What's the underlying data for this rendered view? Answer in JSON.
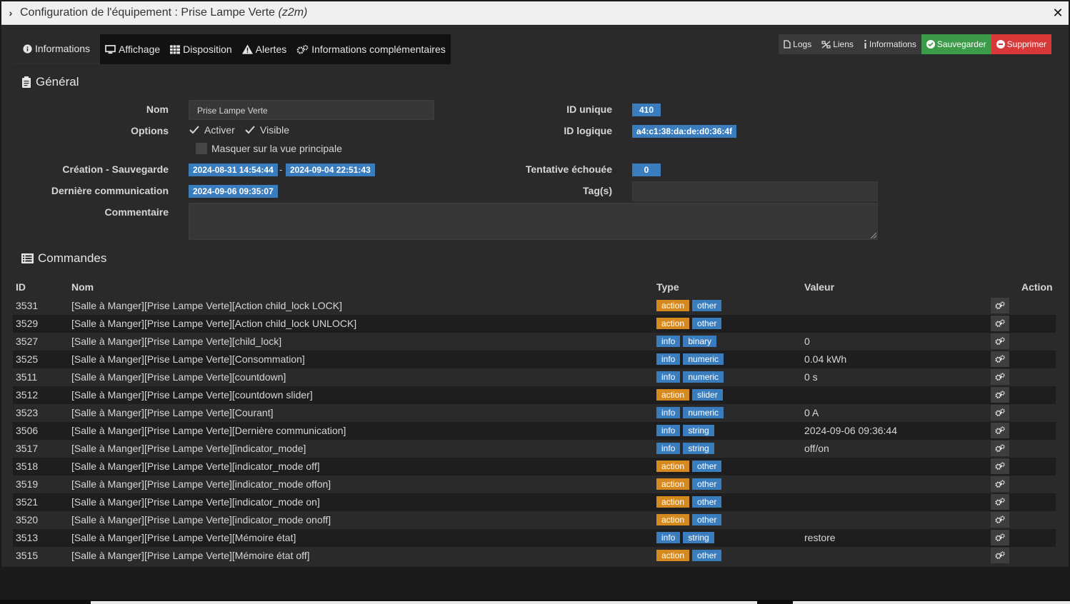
{
  "window": {
    "title_prefix": "Configuration de l'équipement : Prise Lampe Verte",
    "title_suffix": "(z2m)",
    "close_glyph": "✕"
  },
  "tabs": [
    {
      "label": "Informations",
      "icon": "info-circle-icon"
    },
    {
      "label": "Affichage",
      "icon": "monitor-icon"
    },
    {
      "label": "Disposition",
      "icon": "grid-icon"
    },
    {
      "label": "Alertes",
      "icon": "warning-icon"
    },
    {
      "label": "Informations complémentaires",
      "icon": "gears-icon"
    }
  ],
  "toolbar": {
    "logs": "Logs",
    "liens": "Liens",
    "informations": "Informations",
    "sauvegarder": "Sauvegarder",
    "supprimer": "Supprimer"
  },
  "general": {
    "title": "Général",
    "nom_label": "Nom",
    "nom_value": "Prise Lampe Verte",
    "options_label": "Options",
    "activer": "Activer",
    "visible": "Visible",
    "masquer": "Masquer sur la vue principale",
    "creation_label": "Création - Sauvegarde",
    "creation_date": "2024-08-31 14:54:44",
    "sauvegarde_date": "2024-09-04 22:51:43",
    "derniere_label": "Dernière communication",
    "derniere_date": "2024-09-06 09:35:07",
    "commentaire_label": "Commentaire",
    "id_unique_label": "ID unique",
    "id_unique": "410",
    "id_logique_label": "ID logique",
    "id_logique": "a4:c1:38:da:de:d0:36:4f",
    "tentative_label": "Tentative échouée",
    "tentative": "0",
    "tags_label": "Tag(s)"
  },
  "commandes": {
    "title": "Commandes",
    "headers": {
      "id": "ID",
      "nom": "Nom",
      "type": "Type",
      "valeur": "Valeur",
      "action": "Action"
    },
    "rows": [
      {
        "id": "3531",
        "nom": "[Salle à Manger][Prise Lampe Verte][Action child_lock LOCK]",
        "type": "action",
        "subtype": "other",
        "valeur": ""
      },
      {
        "id": "3529",
        "nom": "[Salle à Manger][Prise Lampe Verte][Action child_lock UNLOCK]",
        "type": "action",
        "subtype": "other",
        "valeur": ""
      },
      {
        "id": "3527",
        "nom": "[Salle à Manger][Prise Lampe Verte][child_lock]",
        "type": "info",
        "subtype": "binary",
        "valeur": "0"
      },
      {
        "id": "3525",
        "nom": "[Salle à Manger][Prise Lampe Verte][Consommation]",
        "type": "info",
        "subtype": "numeric",
        "valeur": "0.04 kWh"
      },
      {
        "id": "3511",
        "nom": "[Salle à Manger][Prise Lampe Verte][countdown]",
        "type": "info",
        "subtype": "numeric",
        "valeur": "0 s"
      },
      {
        "id": "3512",
        "nom": "[Salle à Manger][Prise Lampe Verte][countdown slider]",
        "type": "action",
        "subtype": "slider",
        "valeur": ""
      },
      {
        "id": "3523",
        "nom": "[Salle à Manger][Prise Lampe Verte][Courant]",
        "type": "info",
        "subtype": "numeric",
        "valeur": "0 A"
      },
      {
        "id": "3506",
        "nom": "[Salle à Manger][Prise Lampe Verte][Dernière communication]",
        "type": "info",
        "subtype": "string",
        "valeur": "2024-09-06 09:36:44"
      },
      {
        "id": "3517",
        "nom": "[Salle à Manger][Prise Lampe Verte][indicator_mode]",
        "type": "info",
        "subtype": "string",
        "valeur": "off/on"
      },
      {
        "id": "3518",
        "nom": "[Salle à Manger][Prise Lampe Verte][indicator_mode off]",
        "type": "action",
        "subtype": "other",
        "valeur": ""
      },
      {
        "id": "3519",
        "nom": "[Salle à Manger][Prise Lampe Verte][indicator_mode offon]",
        "type": "action",
        "subtype": "other",
        "valeur": ""
      },
      {
        "id": "3521",
        "nom": "[Salle à Manger][Prise Lampe Verte][indicator_mode on]",
        "type": "action",
        "subtype": "other",
        "valeur": ""
      },
      {
        "id": "3520",
        "nom": "[Salle à Manger][Prise Lampe Verte][indicator_mode onoff]",
        "type": "action",
        "subtype": "other",
        "valeur": ""
      },
      {
        "id": "3513",
        "nom": "[Salle à Manger][Prise Lampe Verte][Mémoire état]",
        "type": "info",
        "subtype": "string",
        "valeur": "restore"
      },
      {
        "id": "3515",
        "nom": "[Salle à Manger][Prise Lampe Verte][Mémoire état off]",
        "type": "action",
        "subtype": "other",
        "valeur": ""
      }
    ]
  },
  "colors": {
    "action": "#d6891e",
    "info": "#3a7dbf",
    "save": "#3b9b48",
    "delete": "#d83838"
  }
}
